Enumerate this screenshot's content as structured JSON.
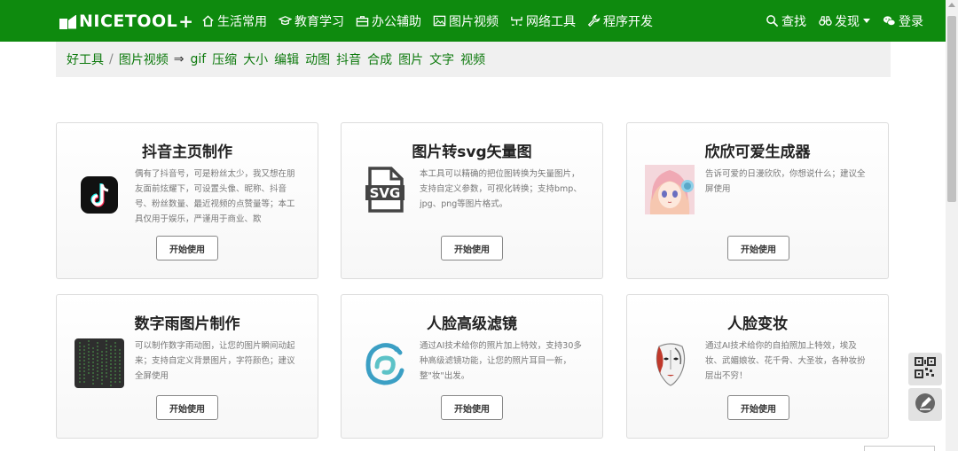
{
  "brand": {
    "logo_text": "NICETOOL",
    "logo_plus": "+"
  },
  "nav": [
    {
      "label": "生活常用",
      "icon": "home-icon"
    },
    {
      "label": "教育学习",
      "icon": "graduation-cap-icon"
    },
    {
      "label": "办公辅助",
      "icon": "briefcase-icon"
    },
    {
      "label": "图片视频",
      "icon": "image-icon"
    },
    {
      "label": "网络工具",
      "icon": "network-icon"
    },
    {
      "label": "程序开发",
      "icon": "wrench-icon"
    }
  ],
  "nav_right": {
    "search": "查找",
    "discover": "发现",
    "login": "登录"
  },
  "breadcrumb": {
    "home": "好工具",
    "separator": "/",
    "category": "图片视频",
    "arrow": "⇒",
    "tags": [
      "gif",
      "压缩",
      "大小",
      "编辑",
      "动图",
      "抖音",
      "合成",
      "图片",
      "文字",
      "视频"
    ]
  },
  "cards": [
    {
      "title": "抖音主页制作",
      "icon": "tiktok-icon",
      "desc": "偶有了抖音号，可是粉丝太少，我又想在朋友面前炫耀下，可设置头像、昵称、抖音号、粉丝数量、最近视频的点赞量等；本工具仅用于娱乐，严谨用于商业、欺",
      "button": "开始使用"
    },
    {
      "title": "图片转svg矢量图",
      "icon": "svg-file-icon",
      "icon_text": "SVG",
      "desc": "本工具可以精确的把位图转换为矢量图片，支持自定义参数，可视化转换；支持bmp、jpg、png等图片格式。",
      "button": "开始使用"
    },
    {
      "title": "欣欣可爱生成器",
      "icon": "anime-girl-icon",
      "desc": "告诉可爱的日漫欣欣，你想说什么；建议全屏使用",
      "button": "开始使用"
    },
    {
      "title": "数字雨图片制作",
      "icon": "digital-rain-icon",
      "desc": "可以制作数字雨动图，让您的图片瞬间动起来；支持自定义背景图片，字符颜色；建议全屏使用",
      "button": "开始使用"
    },
    {
      "title": "人脸高级滤镜",
      "icon": "ai-filter-logo-icon",
      "desc": "通过AI技术给你的照片加上特效，支持30多种高级滤镜功能，让您的照片耳目一新，整\"妆\"出发。",
      "button": "开始使用"
    },
    {
      "title": "人脸变妆",
      "icon": "opera-mask-icon",
      "desc": "通过AI技术给你的自拍照加上特效，埃及妆、武媚娘妆、花千骨、大圣妆，各种妆扮层出不穷！",
      "button": "开始使用"
    }
  ],
  "colors": {
    "header": "#0e8a0e",
    "link": "#0e7a0e",
    "crumb_bg": "#f0f0f0"
  },
  "side_buttons": [
    {
      "icon": "qr-code-icon"
    },
    {
      "icon": "feedback-pen-icon"
    }
  ]
}
